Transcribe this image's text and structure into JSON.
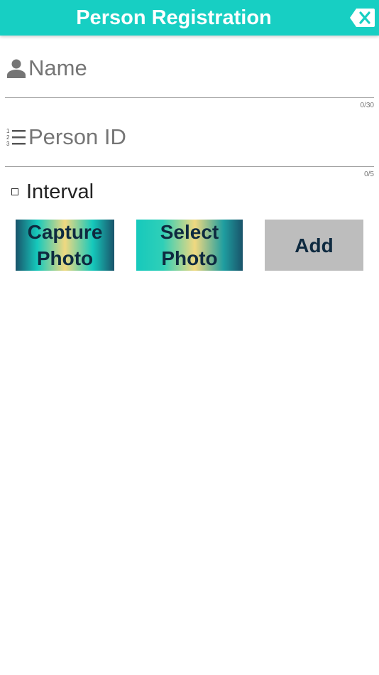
{
  "header": {
    "title": "Person Registration",
    "close_icon": "backspace-x-icon"
  },
  "name_field": {
    "placeholder": "Name",
    "value": "",
    "counter": "0/30",
    "icon": "person-icon"
  },
  "person_id_field": {
    "placeholder": "Person ID",
    "value": "",
    "counter": "0/5",
    "icon": "numbered-list-icon"
  },
  "interval": {
    "label": "Interval",
    "checked": false
  },
  "buttons": {
    "capture_line1": "Capture",
    "capture_line2": "Photo",
    "select_line1": "Select",
    "select_line2": "Photo",
    "add": "Add"
  },
  "colors": {
    "header_bg": "#17cfc3",
    "button_text": "#0e2a40",
    "add_bg": "#bdbdbd"
  }
}
